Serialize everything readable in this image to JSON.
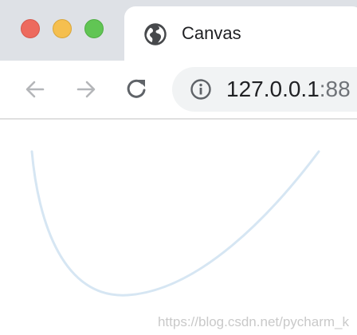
{
  "window": {
    "controls": [
      "close",
      "minimize",
      "zoom"
    ]
  },
  "tab": {
    "title": "Canvas",
    "favicon": "globe-icon"
  },
  "toolbar": {
    "back": "back-arrow-icon",
    "forward": "forward-arrow-icon",
    "reload": "reload-icon"
  },
  "address_bar": {
    "site_info_icon": "info-icon",
    "host": "127.0.0.1",
    "port": ":88"
  },
  "page": {
    "watermark": "https://blog.csdn.net/pycharm_k"
  },
  "colors": {
    "tab_strip": "#dee1e6",
    "curve": "#d6e6f3",
    "close": "#ed6a5e",
    "minimize": "#f5bf4f",
    "zoom": "#61c554"
  }
}
